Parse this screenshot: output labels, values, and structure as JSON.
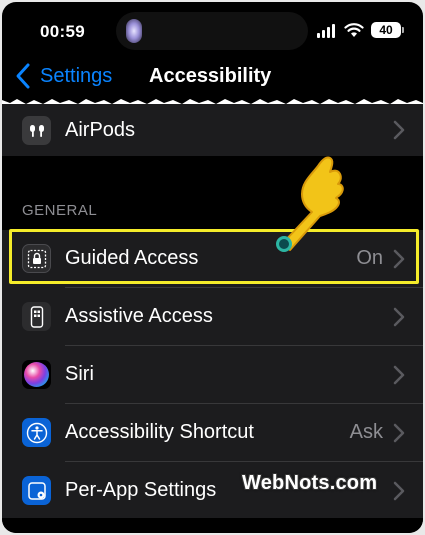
{
  "status_bar": {
    "time": "00:59",
    "battery": "40"
  },
  "nav": {
    "back_label": "Settings",
    "title": "Accessibility"
  },
  "top_group": {
    "items": [
      {
        "label": "AirPods",
        "icon": "airpods-icon"
      }
    ]
  },
  "general": {
    "header": "GENERAL",
    "items": [
      {
        "label": "Guided Access",
        "value": "On",
        "icon": "guided-access-lock-icon"
      },
      {
        "label": "Assistive Access",
        "value": "",
        "icon": "assistive-access-phone-icon"
      },
      {
        "label": "Siri",
        "value": "",
        "icon": "siri-icon"
      },
      {
        "label": "Accessibility Shortcut",
        "value": "Ask",
        "icon": "accessibility-person-icon"
      },
      {
        "label": "Per-App Settings",
        "value": "",
        "icon": "per-app-settings-icon"
      }
    ]
  },
  "watermark": "WebNots.com",
  "colors": {
    "accent": "#0a84ff",
    "highlight": "#f5ec2a",
    "cell_bg": "#1c1c1e",
    "secondary_text": "#8e8e93"
  }
}
